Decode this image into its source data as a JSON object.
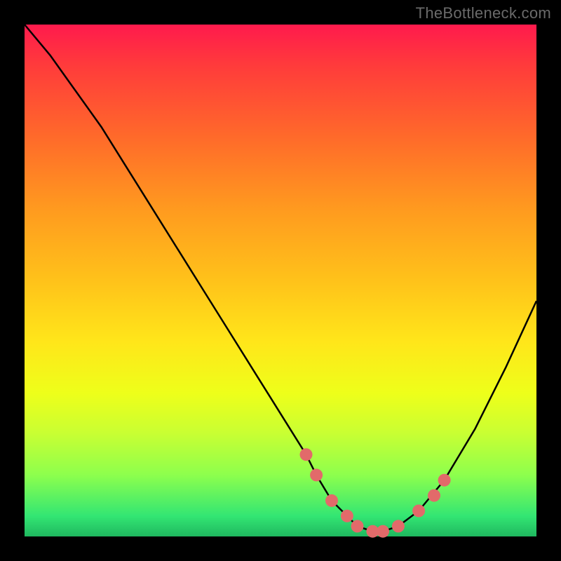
{
  "watermark": "TheBottleneck.com",
  "chart_data": {
    "type": "line",
    "title": "",
    "xlabel": "",
    "ylabel": "",
    "xlim": [
      0,
      100
    ],
    "ylim": [
      0,
      100
    ],
    "grid": false,
    "legend": false,
    "series": [
      {
        "name": "curve",
        "stroke": "#000000",
        "x": [
          0,
          5,
          10,
          15,
          20,
          25,
          30,
          35,
          40,
          45,
          50,
          55,
          57,
          60,
          63,
          65,
          68,
          70,
          73,
          77,
          82,
          88,
          94,
          100
        ],
        "y": [
          100,
          94,
          87,
          80,
          72,
          64,
          56,
          48,
          40,
          32,
          24,
          16,
          12,
          7,
          4,
          2,
          1,
          1,
          2,
          5,
          11,
          21,
          33,
          46
        ]
      }
    ],
    "markers": {
      "color": "#e26a6a",
      "points": [
        {
          "x": 55,
          "y": 16
        },
        {
          "x": 57,
          "y": 12
        },
        {
          "x": 60,
          "y": 7
        },
        {
          "x": 63,
          "y": 4
        },
        {
          "x": 65,
          "y": 2
        },
        {
          "x": 68,
          "y": 1
        },
        {
          "x": 70,
          "y": 1
        },
        {
          "x": 73,
          "y": 2
        },
        {
          "x": 77,
          "y": 5
        },
        {
          "x": 80,
          "y": 8
        },
        {
          "x": 82,
          "y": 11
        }
      ]
    },
    "colors": {
      "background_top": "#ff1a4d",
      "background_bottom": "#1fb85f",
      "frame": "#000000",
      "marker": "#e26a6a"
    }
  }
}
